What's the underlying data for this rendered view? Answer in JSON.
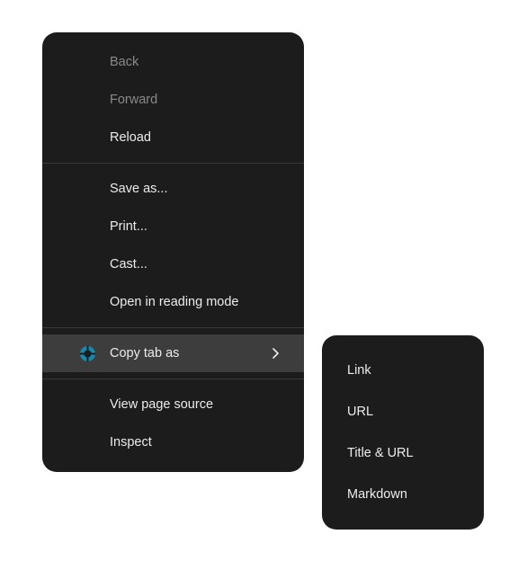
{
  "menu": {
    "groups": [
      {
        "items": [
          {
            "label": "Back",
            "disabled": true
          },
          {
            "label": "Forward",
            "disabled": true
          },
          {
            "label": "Reload",
            "disabled": false
          }
        ]
      },
      {
        "items": [
          {
            "label": "Save as...",
            "disabled": false
          },
          {
            "label": "Print...",
            "disabled": false
          },
          {
            "label": "Cast...",
            "disabled": false
          },
          {
            "label": "Open in reading mode",
            "disabled": false
          }
        ]
      },
      {
        "items": [
          {
            "label": "Copy tab as",
            "disabled": false,
            "highlighted": true,
            "hasSubmenu": true,
            "icon": "tab-copy-icon"
          }
        ]
      },
      {
        "items": [
          {
            "label": "View page source",
            "disabled": false
          },
          {
            "label": "Inspect",
            "disabled": false
          }
        ]
      }
    ]
  },
  "submenu": {
    "items": [
      {
        "label": "Link"
      },
      {
        "label": "URL"
      },
      {
        "label": "Title & URL"
      },
      {
        "label": "Markdown"
      }
    ]
  }
}
